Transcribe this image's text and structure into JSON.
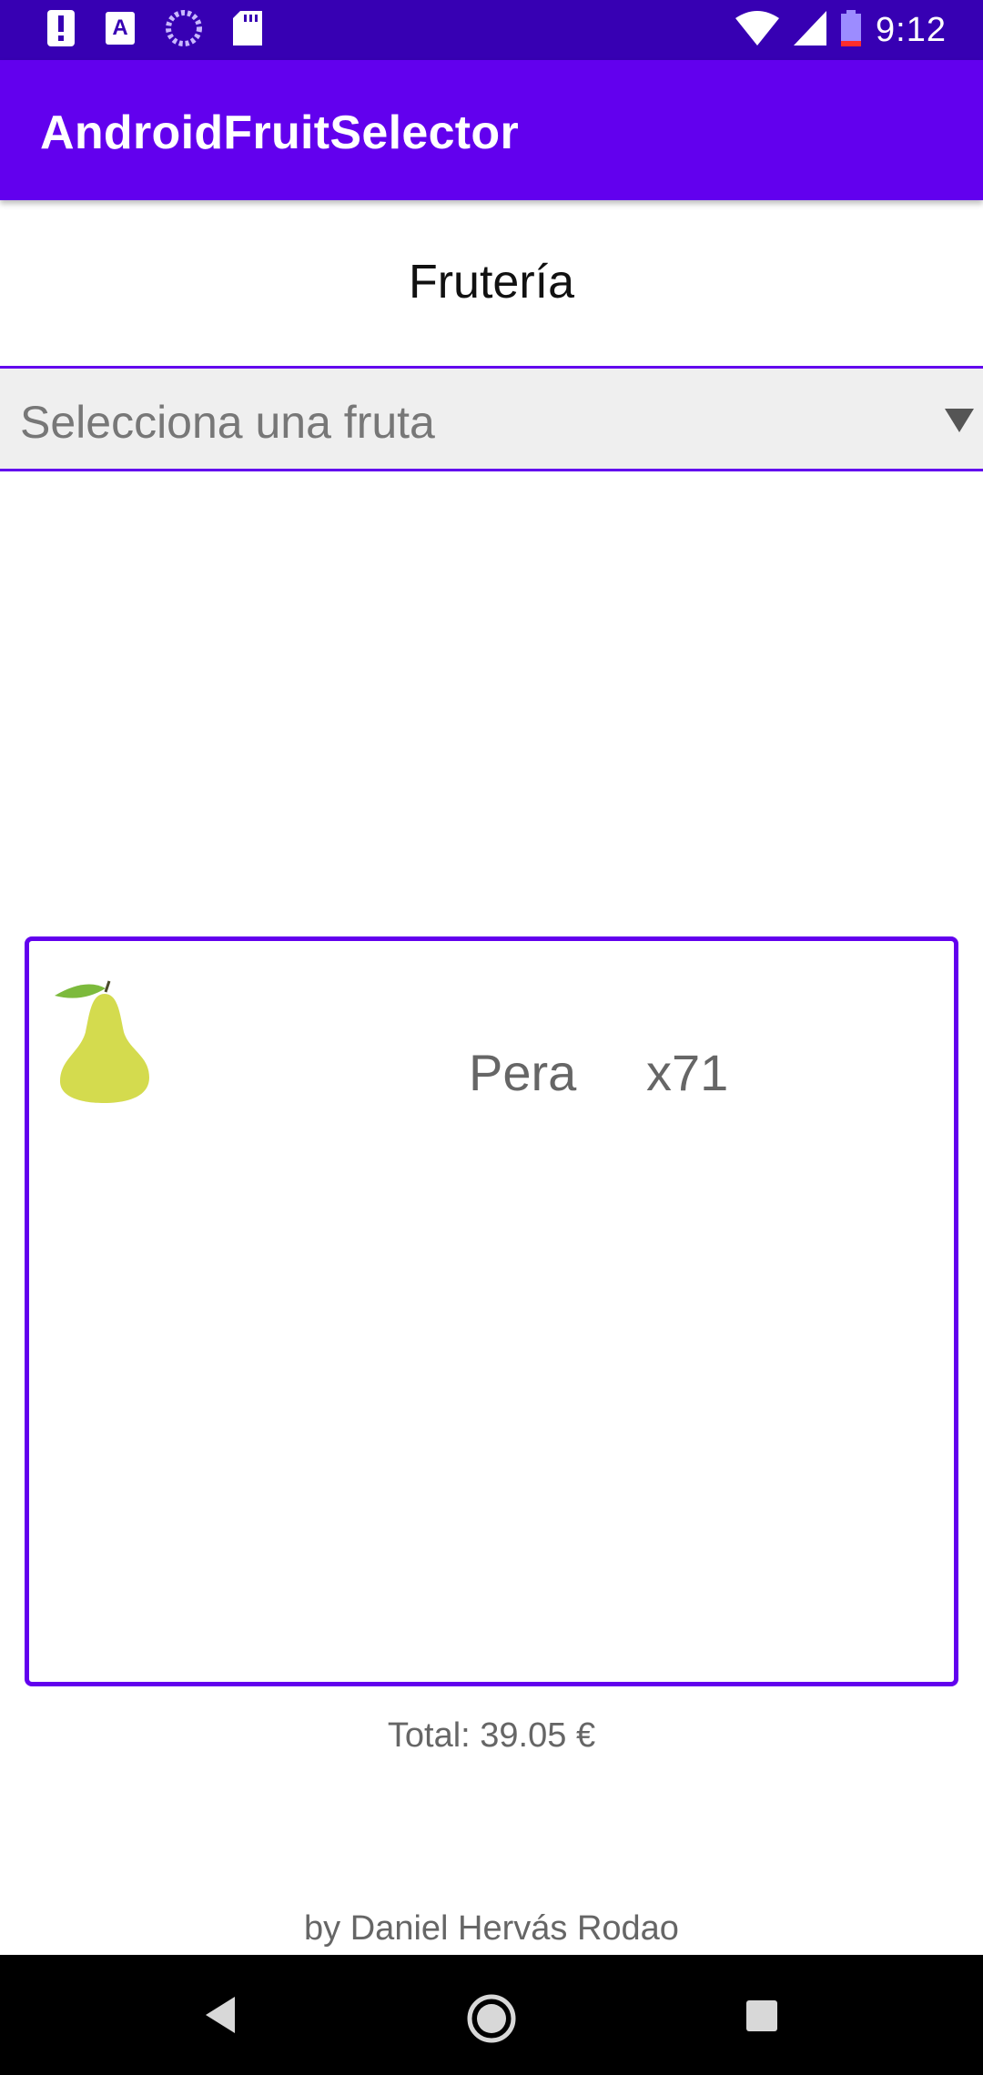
{
  "status_bar": {
    "time": "9:12",
    "left_icons": [
      "alert-icon",
      "font-icon",
      "loading-icon",
      "sd-card-icon"
    ],
    "right_icons": [
      "wifi-icon",
      "signal-icon",
      "battery-icon"
    ]
  },
  "app_bar": {
    "title": "AndroidFruitSelector"
  },
  "header": {
    "title": "Frutería"
  },
  "spinner": {
    "placeholder": "Selecciona una fruta"
  },
  "cart": {
    "items": [
      {
        "icon": "pear-icon",
        "name": "Pera",
        "quantity": "x71"
      }
    ]
  },
  "total": "Total: 39.05 €",
  "footer": "by Daniel Hervás Rodao",
  "colors": {
    "status_bar": "#3700B3",
    "primary": "#6200EE",
    "pear": "#D4DB4E",
    "leaf": "#7CBA3C"
  },
  "nav_bar": [
    "back-icon",
    "home-icon",
    "recents-icon"
  ]
}
